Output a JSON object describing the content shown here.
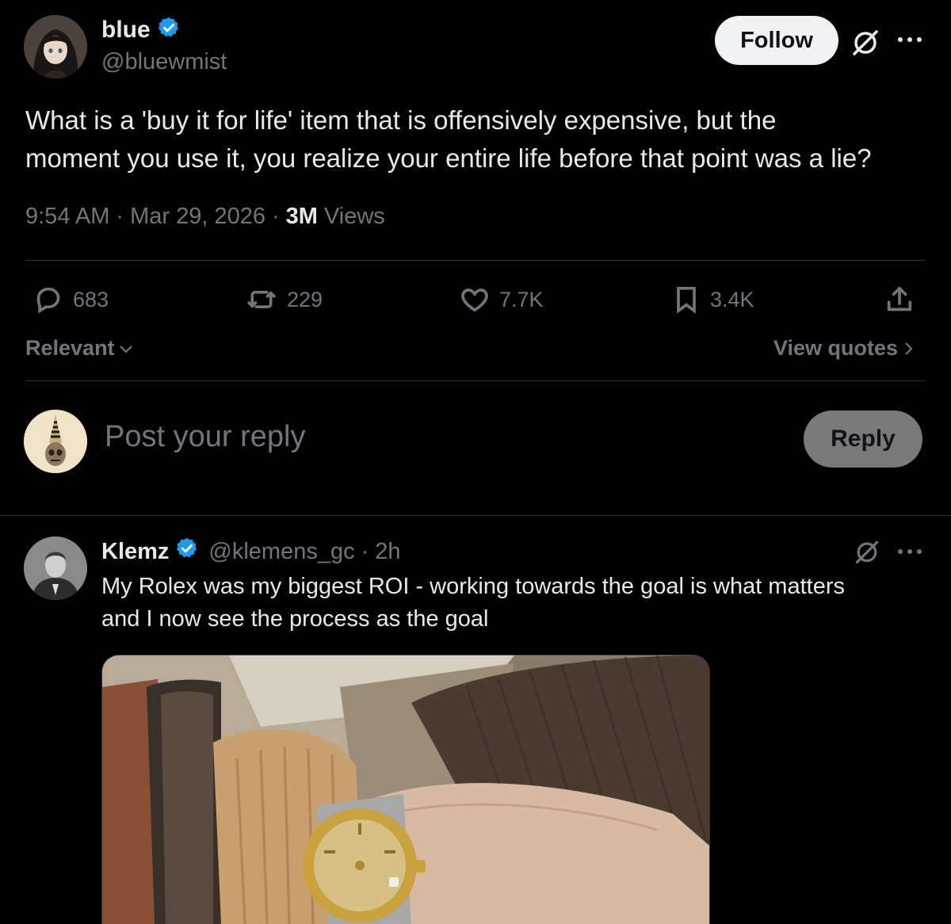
{
  "post": {
    "author_name": "blue",
    "author_handle": "@bluewmist",
    "follow_label": "Follow",
    "text_line1": "What is a 'buy it for life' item that is offensively expensive, but the",
    "text_line2": "moment you use it, you realize your entire life before that point was a lie?",
    "time": "9:54 AM",
    "date": "Mar 29, 2026",
    "sep": "·",
    "views_count": "3M",
    "views_label": "Views",
    "replies": "683",
    "reposts": "229",
    "likes": "7.7K",
    "bookmarks": "3.4K"
  },
  "sort": {
    "label": "Relevant",
    "view_quotes": "View quotes"
  },
  "composer": {
    "placeholder": "Post your reply",
    "reply_label": "Reply"
  },
  "reply": {
    "author_name": "Klemz",
    "author_handle": "@klemens_gc",
    "time_ago": "2h",
    "sep": "·",
    "text_line1": "My Rolex was my biggest ROI - working towards the goal is what matters",
    "text_line2": "and I now see the process as the goal"
  },
  "icons": {
    "verified": "verified-badge-icon",
    "grok": "grok-icon",
    "more": "more-icon",
    "reply": "reply-icon",
    "repost": "repost-icon",
    "like": "like-icon",
    "bookmark": "bookmark-icon",
    "share": "share-icon"
  },
  "colors": {
    "background": "#000000",
    "text": "#e7e9ea",
    "muted": "#71767b",
    "verified": "#1d9bf0",
    "divider": "#2f3336"
  }
}
